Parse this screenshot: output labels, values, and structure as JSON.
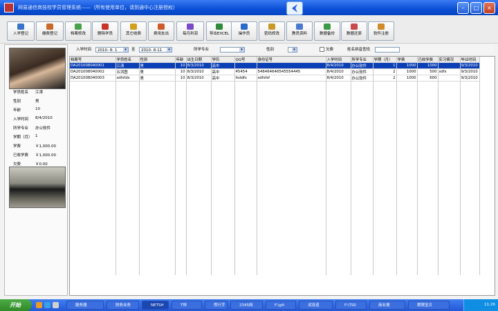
{
  "window": {
    "title": "网易通信商技校学员管理系统——（所有使用单位，请到通中心注册授权）"
  },
  "toolbar": {
    "buttons": [
      {
        "label": "入学登记",
        "icon": "person-add-icon",
        "color": "#3a74c8"
      },
      {
        "label": "缴费登记",
        "icon": "money-icon",
        "color": "#c86a2a"
      },
      {
        "label": "档案修改",
        "icon": "edit-icon",
        "color": "#4aa14a"
      },
      {
        "label": "删除学员",
        "icon": "delete-icon",
        "color": "#c8342a"
      },
      {
        "label": "其它收费",
        "icon": "coins-icon",
        "color": "#d0a020"
      },
      {
        "label": "费用支出",
        "icon": "expense-icon",
        "color": "#d05a2a"
      },
      {
        "label": "每月利润",
        "icon": "chart-icon",
        "color": "#7a4ac8"
      },
      {
        "label": "导出EXCEL",
        "icon": "excel-icon",
        "color": "#2f8a3a"
      },
      {
        "label": "操作员",
        "icon": "operator-icon",
        "color": "#2a6ac8"
      },
      {
        "label": "密码修改",
        "icon": "key-icon",
        "color": "#c89a2a"
      },
      {
        "label": "教员资料",
        "icon": "teacher-icon",
        "color": "#4a7ad0"
      },
      {
        "label": "数据备份",
        "icon": "backup-icon",
        "color": "#3a9a4a"
      },
      {
        "label": "数据还原",
        "icon": "restore-icon",
        "color": "#c84a4a"
      },
      {
        "label": "软件注册",
        "icon": "register-icon",
        "color": "#d08a2a"
      }
    ]
  },
  "filter": {
    "admission_label": "入学时间",
    "date_from": "2010- 8- 1",
    "to_label": "至",
    "date_to": "2010- 8-11",
    "major_label": "所学专业",
    "gender_label": "性别",
    "owe_label": "欠费",
    "pinyin_label": "姓名拼音查找",
    "pinyin_value": ""
  },
  "student": {
    "fields": [
      {
        "k": "学员姓名",
        "v": "江涛"
      },
      {
        "k": "性别",
        "v": "男"
      },
      {
        "k": "年龄",
        "v": "10"
      },
      {
        "k": "入学时间",
        "v": "8/4/2010"
      },
      {
        "k": "所学专业",
        "v": "办公软件"
      },
      {
        "k": "学期（月）",
        "v": "1"
      },
      {
        "k": "学费",
        "v": "￥1,000.00"
      },
      {
        "k": "已收学费",
        "v": "￥1,000.00"
      },
      {
        "k": "欠费",
        "v": "￥0.00"
      }
    ]
  },
  "table": {
    "headers": [
      "档案号",
      "学员姓名",
      "性别",
      "年龄",
      "出生日期",
      "学历",
      "QQ号",
      "身份证号",
      "入学时间",
      "所学专业",
      "学期（月）",
      "学费",
      "已收学费",
      "实习情况",
      "毕业时间"
    ],
    "rows": [
      [
        "DA201008040001",
        "江涛",
        "男",
        "10",
        "8/3/2010",
        "高中",
        "",
        "",
        "8/4/2010",
        "办公软件",
        "1",
        "1000",
        "1000",
        "",
        "9/3/2010"
      ],
      [
        "DA201008040002",
        "五洪图",
        "男",
        "10",
        "8/3/2010",
        "高中",
        "45454",
        "546464646545554445",
        "8/4/2010",
        "办公软件",
        "2",
        "1000",
        "500",
        "sdfs",
        "9/3/2010"
      ],
      [
        "DA201008040003",
        "sdfsfds",
        "男",
        "10",
        "8/3/2010",
        "高中",
        "fsddfs",
        "sdfsfsf",
        "8/4/2010",
        "办公软件",
        "2",
        "1000",
        "600",
        "",
        "9/3/2010"
      ]
    ]
  },
  "taskbar": {
    "start": "开始",
    "tasks": [
      "服务器",
      "财务业务",
      "NETSH",
      "T恒",
      "思行字",
      "2345网",
      "F:\\g4-",
      "试设道",
      "F:\\TS0",
      "商业搜",
      "期限宝贝"
    ],
    "clock": "11:26"
  }
}
